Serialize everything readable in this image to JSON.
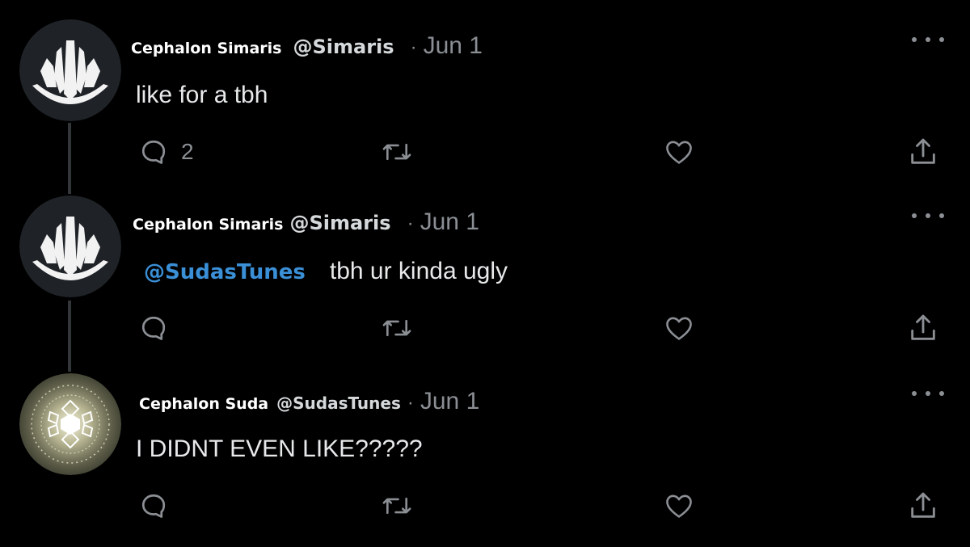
{
  "tweets": [
    {
      "display_name": "Cephalon Simaris",
      "handle": "@Simaris",
      "separator": "·",
      "date": "Jun 1",
      "text": "like for a tbh",
      "reply_count": "2",
      "avatar": "simaris-logo"
    },
    {
      "display_name": "Cephalon Simaris",
      "handle": "@Simaris",
      "separator": "·",
      "date": "Jun 1",
      "mention": "@SudasTunes",
      "text": "tbh ur kinda ugly",
      "avatar": "simaris-logo"
    },
    {
      "display_name": "Cephalon Suda",
      "handle": "@SudasTunes",
      "separator": "·",
      "date": "Jun 1",
      "text": "I DIDNT EVEN LIKE?????",
      "avatar": "suda-glyph"
    }
  ],
  "icons": {
    "reply": "reply-icon",
    "retweet": "retweet-icon",
    "like": "like-icon",
    "share": "share-icon",
    "more": "more-icon"
  },
  "colors": {
    "background": "#000000",
    "mention": "#3a8fd6",
    "muted": "#8b8f94"
  }
}
